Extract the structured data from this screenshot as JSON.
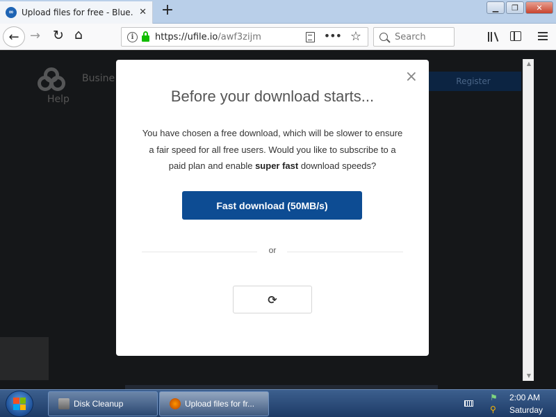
{
  "browser": {
    "tab_title": "Upload files for free - Blue.zip -",
    "url_host": "https://ufile.io",
    "url_path": "/awf3zijm",
    "search_placeholder": "Search"
  },
  "page_background": {
    "business_text": "Busine",
    "help_text": "Help",
    "register_text": "Register"
  },
  "modal": {
    "title": "Before your download starts...",
    "text_before_bold": "You have chosen a free download, which will be slower to ensure a fair speed for all free users. Would you like to subscribe to a paid plan and enable ",
    "text_bold": "super fast",
    "text_after_bold": " download speeds?",
    "fast_button_label": "Fast download (50MB/s)",
    "or_label": "or",
    "close_glyph": "×",
    "spinner_glyph": "⟳"
  },
  "taskbar": {
    "tasks": [
      {
        "label": "Disk Cleanup"
      },
      {
        "label": "Upload files for fr..."
      }
    ],
    "clock_time": "2:00 AM",
    "clock_day": "Saturday"
  },
  "colors": {
    "modal_button": "#0d4c93",
    "page_overlay": "#151719"
  }
}
